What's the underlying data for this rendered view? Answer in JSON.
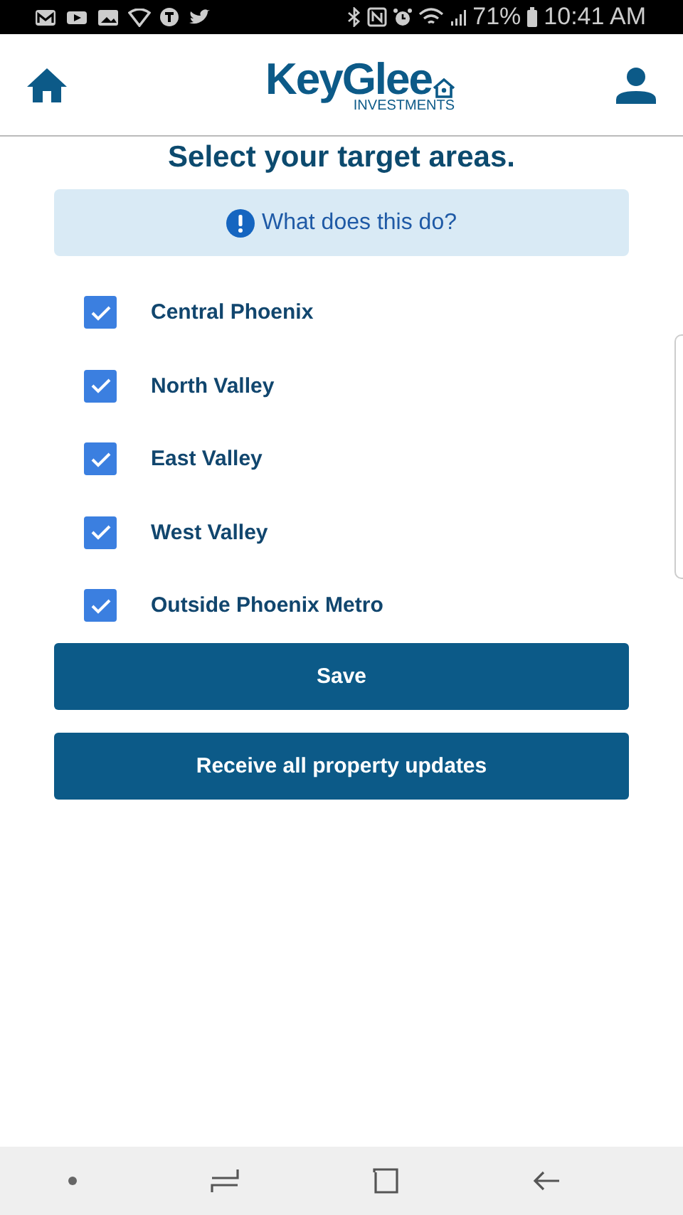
{
  "status_bar": {
    "battery": "71%",
    "time": "10:41 AM"
  },
  "header": {
    "logo": {
      "name": "KeyGlee",
      "tagline": "INVESTMENTS"
    }
  },
  "title": "Select your target areas.",
  "info": {
    "label": "What does this do?"
  },
  "areas": [
    {
      "label": "Central Phoenix",
      "checked": true
    },
    {
      "label": "North Valley",
      "checked": true
    },
    {
      "label": "East Valley",
      "checked": true
    },
    {
      "label": "West Valley",
      "checked": true
    },
    {
      "label": "Outside Phoenix Metro",
      "checked": true
    }
  ],
  "buttons": [
    "Save",
    "Receive all property updates"
  ]
}
